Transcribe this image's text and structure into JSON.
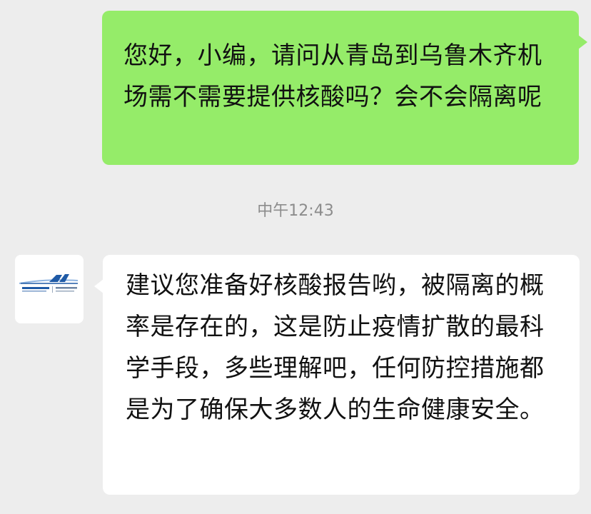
{
  "colors": {
    "background": "#ededed",
    "sent_bubble": "#95ec69",
    "received_bubble": "#ffffff",
    "timestamp": "#8c8c8c",
    "avatar_logo": "#1f5aa6"
  },
  "messages": {
    "sent": {
      "text": "您好，小编，请问从青岛到乌鲁木齐机场需不需要提供核酸吗？会不会隔离呢"
    },
    "timestamp": "中午12:43",
    "received": {
      "avatar_icon": "airport-logo-icon",
      "text": "建议您准备好核酸报告哟，被隔离的概率是存在的，这是防止疫情扩散的最科学手段，多些理解吧，任何防控措施都是为了确保大多数人的生命健康安全。"
    }
  }
}
